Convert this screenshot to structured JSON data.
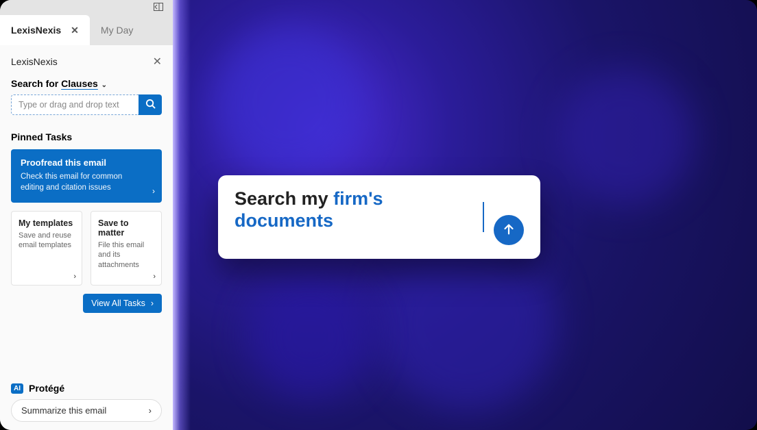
{
  "tabs": {
    "active": "LexisNexis",
    "inactive": "My Day"
  },
  "panel": {
    "title": "LexisNexis",
    "search_label_prefix": "Search for ",
    "search_label_target": "Clauses",
    "search_placeholder": "Type or drag and drop text"
  },
  "pinned": {
    "section_title": "Pinned Tasks",
    "primary": {
      "title": "Proofread this email",
      "desc": "Check this email for common editing and citation issues"
    },
    "cards": [
      {
        "title": "My templates",
        "desc": "Save and reuse email templates"
      },
      {
        "title": "Save to matter",
        "desc": "File this email and its attachments"
      }
    ],
    "view_all": "View All Tasks"
  },
  "protege": {
    "badge": "AI",
    "label": "Protégé",
    "action": "Summarize this email"
  },
  "hero": {
    "prefix": "Search my ",
    "highlight": "firm's documents"
  }
}
